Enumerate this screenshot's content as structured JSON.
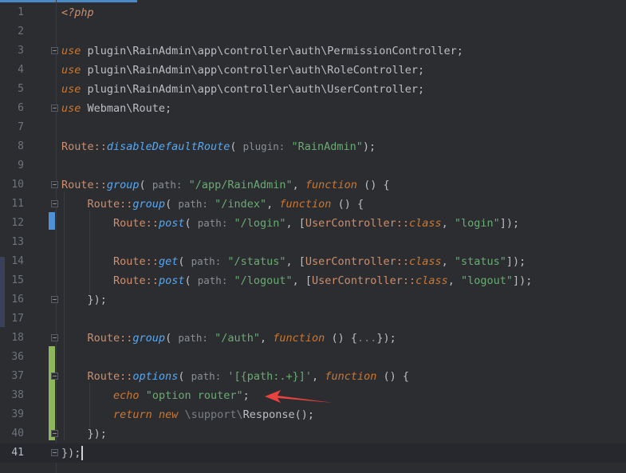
{
  "editor": {
    "lines": [
      {
        "n": "1",
        "tokens": [
          {
            "t": "<?php",
            "c": "php"
          }
        ]
      },
      {
        "n": "2",
        "tokens": []
      },
      {
        "n": "3",
        "tokens": [
          {
            "t": "use",
            "c": "kw"
          },
          {
            "t": " plugin\\RainAdmin\\app\\controller\\auth\\PermissionController;",
            "c": ""
          }
        ]
      },
      {
        "n": "4",
        "tokens": [
          {
            "t": "use",
            "c": "kw"
          },
          {
            "t": " plugin\\RainAdmin\\app\\controller\\auth\\RoleController;",
            "c": ""
          }
        ]
      },
      {
        "n": "5",
        "tokens": [
          {
            "t": "use",
            "c": "kw"
          },
          {
            "t": " plugin\\RainAdmin\\app\\controller\\auth\\UserController;",
            "c": ""
          }
        ]
      },
      {
        "n": "6",
        "tokens": [
          {
            "t": "use",
            "c": "kw"
          },
          {
            "t": " Webman\\Route;",
            "c": ""
          }
        ]
      },
      {
        "n": "7",
        "tokens": []
      },
      {
        "n": "8",
        "tokens": [
          {
            "t": "Route",
            "c": "cls"
          },
          {
            "t": "::",
            "c": "sep"
          },
          {
            "t": "disableDefaultRoute",
            "c": "fn"
          },
          {
            "t": "( ",
            "c": ""
          },
          {
            "t": "plugin:",
            "c": "hint"
          },
          {
            "t": " ",
            "c": ""
          },
          {
            "t": "\"RainAdmin\"",
            "c": "str"
          },
          {
            "t": ");",
            "c": ""
          }
        ]
      },
      {
        "n": "9",
        "tokens": []
      },
      {
        "n": "10",
        "tokens": [
          {
            "t": "Route",
            "c": "cls"
          },
          {
            "t": "::",
            "c": "sep"
          },
          {
            "t": "group",
            "c": "fn"
          },
          {
            "t": "( ",
            "c": ""
          },
          {
            "t": "path:",
            "c": "hint"
          },
          {
            "t": " ",
            "c": ""
          },
          {
            "t": "\"/app/RainAdmin\"",
            "c": "str"
          },
          {
            "t": ", ",
            "c": ""
          },
          {
            "t": "function",
            "c": "kw"
          },
          {
            "t": " () {",
            "c": ""
          }
        ]
      },
      {
        "n": "11",
        "tokens": [
          {
            "t": "    ",
            "c": ""
          },
          {
            "t": "Route",
            "c": "cls"
          },
          {
            "t": "::",
            "c": "sep"
          },
          {
            "t": "group",
            "c": "fn"
          },
          {
            "t": "( ",
            "c": ""
          },
          {
            "t": "path:",
            "c": "hint"
          },
          {
            "t": " ",
            "c": ""
          },
          {
            "t": "\"/index\"",
            "c": "str"
          },
          {
            "t": ", ",
            "c": ""
          },
          {
            "t": "function",
            "c": "kw"
          },
          {
            "t": " () {",
            "c": ""
          }
        ]
      },
      {
        "n": "12",
        "tokens": [
          {
            "t": "        ",
            "c": ""
          },
          {
            "t": "Route",
            "c": "cls"
          },
          {
            "t": "::",
            "c": "sep"
          },
          {
            "t": "post",
            "c": "fn"
          },
          {
            "t": "( ",
            "c": ""
          },
          {
            "t": "path:",
            "c": "hint"
          },
          {
            "t": " ",
            "c": ""
          },
          {
            "t": "\"/login\"",
            "c": "str"
          },
          {
            "t": ", [",
            "c": ""
          },
          {
            "t": "UserController",
            "c": "cls"
          },
          {
            "t": "::",
            "c": "sep"
          },
          {
            "t": "class",
            "c": "kw"
          },
          {
            "t": ", ",
            "c": ""
          },
          {
            "t": "\"login\"",
            "c": "str"
          },
          {
            "t": "]);",
            "c": ""
          }
        ]
      },
      {
        "n": "13",
        "tokens": []
      },
      {
        "n": "14",
        "tokens": [
          {
            "t": "        ",
            "c": ""
          },
          {
            "t": "Route",
            "c": "cls"
          },
          {
            "t": "::",
            "c": "sep"
          },
          {
            "t": "get",
            "c": "fn"
          },
          {
            "t": "( ",
            "c": ""
          },
          {
            "t": "path:",
            "c": "hint"
          },
          {
            "t": " ",
            "c": ""
          },
          {
            "t": "\"/status\"",
            "c": "str"
          },
          {
            "t": ", [",
            "c": ""
          },
          {
            "t": "UserController",
            "c": "cls"
          },
          {
            "t": "::",
            "c": "sep"
          },
          {
            "t": "class",
            "c": "kw"
          },
          {
            "t": ", ",
            "c": ""
          },
          {
            "t": "\"status\"",
            "c": "str"
          },
          {
            "t": "]);",
            "c": ""
          }
        ]
      },
      {
        "n": "15",
        "tokens": [
          {
            "t": "        ",
            "c": ""
          },
          {
            "t": "Route",
            "c": "cls"
          },
          {
            "t": "::",
            "c": "sep"
          },
          {
            "t": "post",
            "c": "fn"
          },
          {
            "t": "( ",
            "c": ""
          },
          {
            "t": "path:",
            "c": "hint"
          },
          {
            "t": " ",
            "c": ""
          },
          {
            "t": "\"/logout\"",
            "c": "str"
          },
          {
            "t": ", [",
            "c": ""
          },
          {
            "t": "UserController",
            "c": "cls"
          },
          {
            "t": "::",
            "c": "sep"
          },
          {
            "t": "class",
            "c": "kw"
          },
          {
            "t": ", ",
            "c": ""
          },
          {
            "t": "\"logout\"",
            "c": "str"
          },
          {
            "t": "]);",
            "c": ""
          }
        ]
      },
      {
        "n": "16",
        "tokens": [
          {
            "t": "    });",
            "c": ""
          }
        ]
      },
      {
        "n": "17",
        "tokens": []
      },
      {
        "n": "18",
        "tokens": [
          {
            "t": "    ",
            "c": ""
          },
          {
            "t": "Route",
            "c": "cls"
          },
          {
            "t": "::",
            "c": "sep"
          },
          {
            "t": "group",
            "c": "fn"
          },
          {
            "t": "( ",
            "c": ""
          },
          {
            "t": "path:",
            "c": "hint"
          },
          {
            "t": " ",
            "c": ""
          },
          {
            "t": "\"/auth\"",
            "c": "str"
          },
          {
            "t": ", ",
            "c": ""
          },
          {
            "t": "function",
            "c": "kw"
          },
          {
            "t": " () {",
            "c": ""
          },
          {
            "t": "...",
            "c": "fold"
          },
          {
            "t": "});",
            "c": ""
          }
        ]
      },
      {
        "n": "36",
        "tokens": []
      },
      {
        "n": "37",
        "tokens": [
          {
            "t": "    ",
            "c": ""
          },
          {
            "t": "Route",
            "c": "cls"
          },
          {
            "t": "::",
            "c": "sep"
          },
          {
            "t": "options",
            "c": "fn"
          },
          {
            "t": "( ",
            "c": ""
          },
          {
            "t": "path:",
            "c": "hint"
          },
          {
            "t": " ",
            "c": ""
          },
          {
            "t": "'[{path:.+}]'",
            "c": "str"
          },
          {
            "t": ", ",
            "c": ""
          },
          {
            "t": "function",
            "c": "kw"
          },
          {
            "t": " () {",
            "c": ""
          }
        ]
      },
      {
        "n": "38",
        "tokens": [
          {
            "t": "        ",
            "c": ""
          },
          {
            "t": "echo",
            "c": "kw"
          },
          {
            "t": " ",
            "c": ""
          },
          {
            "t": "\"option router\"",
            "c": "str"
          },
          {
            "t": ";",
            "c": ""
          }
        ]
      },
      {
        "n": "39",
        "tokens": [
          {
            "t": "        ",
            "c": ""
          },
          {
            "t": "return",
            "c": "kw"
          },
          {
            "t": " ",
            "c": ""
          },
          {
            "t": "new",
            "c": "kw"
          },
          {
            "t": " ",
            "c": ""
          },
          {
            "t": "\\support\\",
            "c": "ns"
          },
          {
            "t": "Response();",
            "c": ""
          }
        ]
      },
      {
        "n": "40",
        "tokens": [
          {
            "t": "    });",
            "c": ""
          }
        ]
      },
      {
        "n": "41",
        "tokens": [
          {
            "t": "});",
            "c": ""
          }
        ],
        "current": true
      }
    ]
  },
  "colors": {
    "background": "#2b2d30",
    "keyword": "#cc7832",
    "class": "#cf8e6d",
    "method": "#56a8f5",
    "string": "#6aab73",
    "change_added": "#8db75a",
    "change_modified": "#4f90d6",
    "annotation_arrow": "#e8423f"
  }
}
